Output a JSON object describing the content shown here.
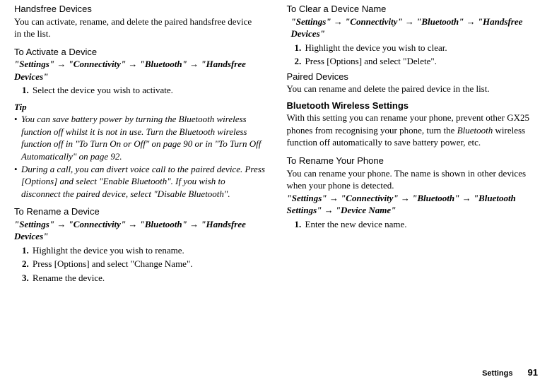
{
  "left": {
    "h1": "Handsfree Devices",
    "p1": "You can activate, rename, and delete the paired handsfree device in the list.",
    "activate_h": "To Activate a Device",
    "activate_path": "\"Settings\" → \"Connectivity\" → \"Bluetooth\" → \"Handsfree Devices\"",
    "activate_steps": [
      "Select the device you wish to activate."
    ],
    "tip_h": "Tip",
    "tips": [
      "You can save battery power by turning the Bluetooth wireless function off whilst it is not in use. Turn the Bluetooth wireless function off in \"To Turn On or Off\" on page 90 or in \"To Turn Off Automatically\" on page 92.",
      "During a call, you can divert voice call to the paired device. Press [Options] and select \"Enable Bluetooth\". If you wish to disconnect the paired device, select \"Disable Bluetooth\"."
    ],
    "rename_h": "To Rename a Device",
    "rename_path": "\"Settings\" → \"Connectivity\" → \"Bluetooth\" → \"Handsfree Devices\"",
    "rename_steps": [
      "Highlight the device you wish to rename.",
      "Press [Options] and select \"Change Name\".",
      "Rename the device."
    ]
  },
  "right": {
    "clear_h": "To Clear a Device Name",
    "clear_path": "\"Settings\" → \"Connectivity\" → \"Bluetooth\" → \"Handsfree Devices\"",
    "clear_steps": [
      "Highlight the device you wish to clear.",
      "Press [Options] and select \"Delete\"."
    ],
    "paired_h": "Paired Devices",
    "paired_p": "You can rename and delete the paired device in the list.",
    "bt_h": "Bluetooth Wireless Settings",
    "bt_p": "With this setting you can rename your phone, prevent other GX25 phones from recognising your phone, turn the Bluetooth wireless function off automatically to save battery power, etc.",
    "rename_phone_h": "To Rename Your Phone",
    "rename_phone_p": "You can rename your phone. The name is shown in other devices when your phone is detected.",
    "rename_phone_path": "\"Settings\" → \"Connectivity\" → \"Bluetooth\" → \"Bluetooth Settings\" → \"Device Name\"",
    "rename_phone_steps": [
      "Enter the new device name."
    ]
  },
  "footer": {
    "section": "Settings",
    "page": "91"
  }
}
